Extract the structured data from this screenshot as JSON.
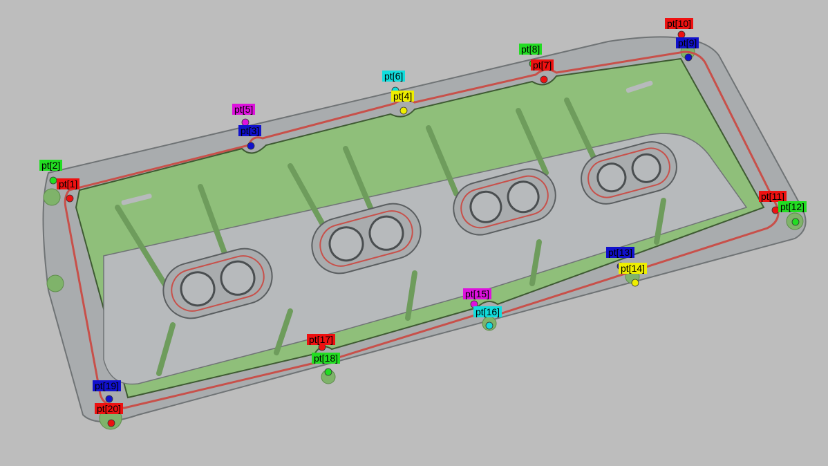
{
  "colors": {
    "background": "#bdbdbd",
    "body_green": "#8fbf7a",
    "body_gray": "#a9acae",
    "gasket_red": "#c8504a",
    "red": "#ee1111",
    "green": "#22dd22",
    "blue": "#1111cc",
    "magenta": "#dd11dd",
    "yellow": "#eeee00",
    "cyan": "#11dddd"
  },
  "points": [
    {
      "label": "pt[1]",
      "color": "red"
    },
    {
      "label": "pt[2]",
      "color": "green"
    },
    {
      "label": "pt[3]",
      "color": "blue"
    },
    {
      "label": "pt[4]",
      "color": "yellow"
    },
    {
      "label": "pt[5]",
      "color": "magenta"
    },
    {
      "label": "pt[6]",
      "color": "cyan"
    },
    {
      "label": "pt[7]",
      "color": "red"
    },
    {
      "label": "pt[8]",
      "color": "green"
    },
    {
      "label": "pt[9]",
      "color": "blue"
    },
    {
      "label": "pt[10]",
      "color": "red"
    },
    {
      "label": "pt[11]",
      "color": "red"
    },
    {
      "label": "pt[12]",
      "color": "green"
    },
    {
      "label": "pt[13]",
      "color": "blue"
    },
    {
      "label": "pt[14]",
      "color": "yellow"
    },
    {
      "label": "pt[15]",
      "color": "magenta"
    },
    {
      "label": "pt[16]",
      "color": "cyan"
    },
    {
      "label": "pt[17]",
      "color": "red"
    },
    {
      "label": "pt[18]",
      "color": "green"
    },
    {
      "label": "pt[19]",
      "color": "blue"
    },
    {
      "label": "pt[20]",
      "color": "red"
    }
  ]
}
